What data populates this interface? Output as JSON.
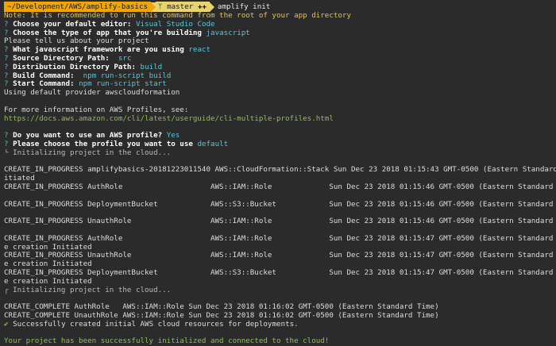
{
  "prompt": {
    "path": "~/Development/AWS/amplify-basics",
    "branch_icon": "ᛘ",
    "branch": "master",
    "git_status": "✚✚",
    "command": "amplify init"
  },
  "lines": {
    "note": "Note: It is recommended to run this command from the root of your app directory",
    "editor_q": "Choose your default editor:",
    "editor_a": "Visual Studio Code",
    "apptype_q": "Choose the type of app that you're building",
    "apptype_a": "javascript",
    "tell": "Please tell us about your project",
    "framework_q": "What javascript framework are you using",
    "framework_a": "react",
    "srcdir_q": "Source Directory Path:",
    "srcdir_a": "src",
    "distdir_q": "Distribution Directory Path:",
    "distdir_a": "build",
    "build_q": "Build Command:",
    "build_a": "npm run-script build",
    "start_q": "Start Command:",
    "start_a": "npm run-script start",
    "provider": "Using default provider awscloudformation",
    "more_info": "For more information on AWS Profiles, see:",
    "url": "https://docs.aws.amazon.com/cli/latest/userguide/cli-multiple-profiles.html",
    "profile_q": "Do you want to use an AWS profile?",
    "profile_a": "Yes",
    "choose_profile_q": "Please choose the profile you want to use",
    "choose_profile_a": "default",
    "init1": "└ Initializing project in the cloud...",
    "l1": "CREATE_IN_PROGRESS amplifybasics-20181223011540 AWS::CloudFormation::Stack Sun Dec 23 2018 01:15:43 GMT-0500 (Eastern Standard Time) User In",
    "l1b": "itiated",
    "l2": "CREATE_IN_PROGRESS AuthRole                    AWS::IAM::Role             Sun Dec 23 2018 01:15:46 GMT-0500 (Eastern Standard Time)",
    "l3": "CREATE_IN_PROGRESS DeploymentBucket            AWS::S3::Bucket            Sun Dec 23 2018 01:15:46 GMT-0500 (Eastern Standard Time)",
    "l4": "CREATE_IN_PROGRESS UnauthRole                  AWS::IAM::Role             Sun Dec 23 2018 01:15:46 GMT-0500 (Eastern Standard Time)",
    "l5": "CREATE_IN_PROGRESS AuthRole                    AWS::IAM::Role             Sun Dec 23 2018 01:15:47 GMT-0500 (Eastern Standard Time) Resourc",
    "l5b": "e creation Initiated",
    "l6": "CREATE_IN_PROGRESS UnauthRole                  AWS::IAM::Role             Sun Dec 23 2018 01:15:47 GMT-0500 (Eastern Standard Time) Resourc",
    "l6b": "e creation Initiated",
    "l7": "CREATE_IN_PROGRESS DeploymentBucket            AWS::S3::Bucket            Sun Dec 23 2018 01:15:47 GMT-0500 (Eastern Standard Time) Resourc",
    "l7b": "e creation Initiated",
    "init2": "┌ Initializing project in the cloud...",
    "c1": "CREATE_COMPLETE AuthRole   AWS::IAM::Role Sun Dec 23 2018 01:16:02 GMT-0500 (Eastern Standard Time)",
    "c2": "CREATE_COMPLETE UnauthRole AWS::IAM::Role Sun Dec 23 2018 01:16:02 GMT-0500 (Eastern Standard Time)",
    "success_mark": "✔",
    "success": "Successfully created initial AWS cloud resources for deployments.",
    "final": "Your project has been successfully initialized and connected to the cloud!"
  },
  "colors": {
    "background": "#2b2b2b",
    "path_segment": "#f0a500",
    "git_segment": "#e9d36c",
    "note": "#e5c24f",
    "answer": "#57c7d8",
    "success": "#8ec246"
  }
}
